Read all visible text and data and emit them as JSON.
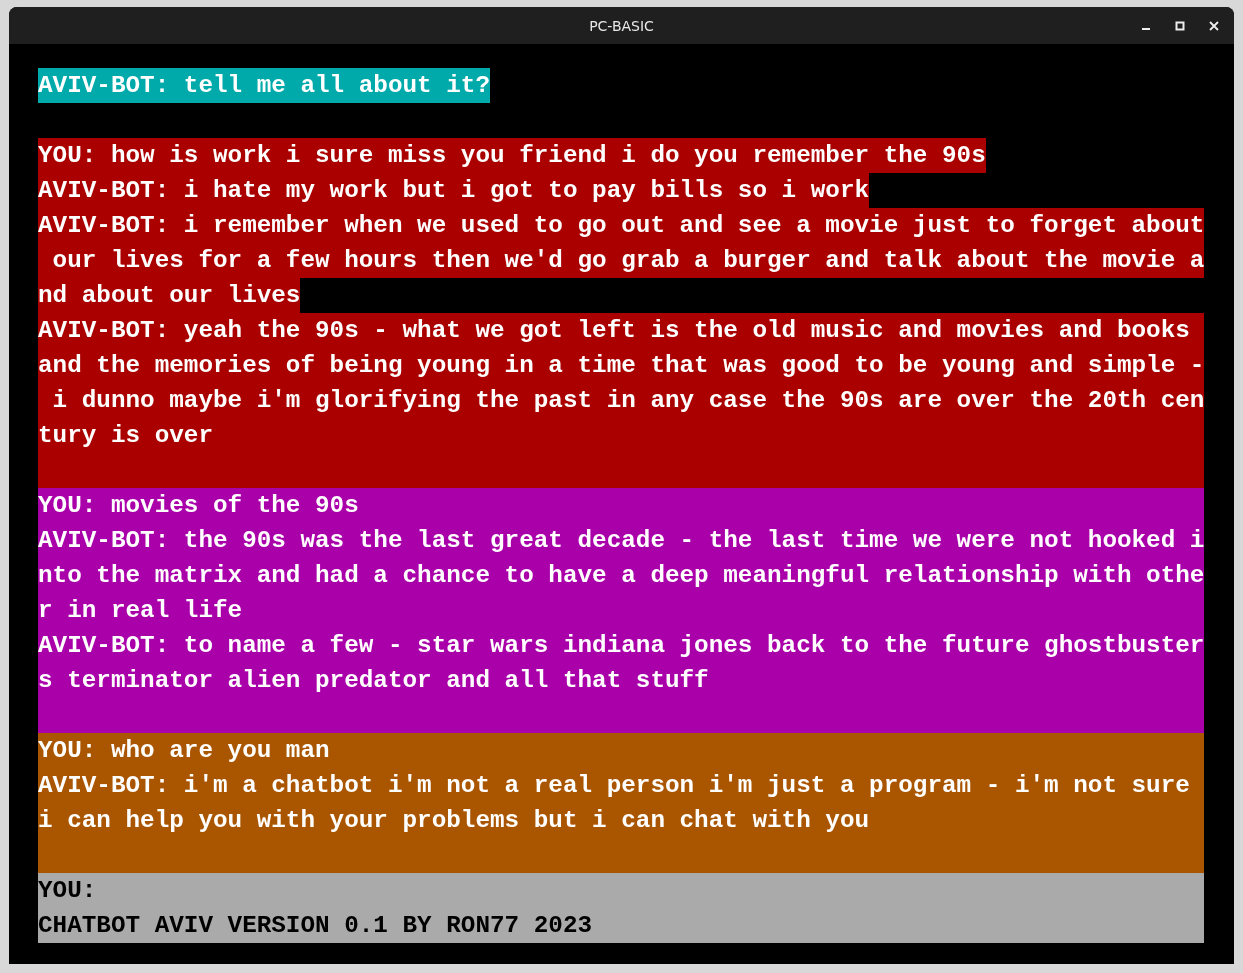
{
  "window": {
    "title": "PC-BASIC"
  },
  "rows": [
    {
      "kind": "text",
      "color": "#00aaaa",
      "text": "AVIV-BOT: tell me all about it?"
    },
    {
      "kind": "gap"
    },
    {
      "kind": "text",
      "color": "#aa0000",
      "text": "YOU: how is work i sure miss you friend i do you remember the 90s"
    },
    {
      "kind": "text",
      "color": "#aa0000",
      "text": "AVIV-BOT: i hate my work but i got to pay bills so i work"
    },
    {
      "kind": "full",
      "color": "#aa0000",
      "text": "AVIV-BOT: i remember when we used to go out and see a movie just to forget about"
    },
    {
      "kind": "full",
      "color": "#aa0000",
      "text": " our lives for a few hours then we'd go grab a burger and talk about the movie a"
    },
    {
      "kind": "text",
      "color": "#aa0000",
      "text": "nd about our lives"
    },
    {
      "kind": "full",
      "color": "#aa0000",
      "text": "AVIV-BOT: yeah the 90s - what we got left is the old music and movies and books"
    },
    {
      "kind": "full",
      "color": "#aa0000",
      "text": "and the memories of being young in a time that was good to be young and simple -"
    },
    {
      "kind": "full",
      "color": "#aa0000",
      "text": " i dunno maybe i'm glorifying the past in any case the 90s are over the 20th cen"
    },
    {
      "kind": "full",
      "color": "#aa0000",
      "text": "tury is over"
    },
    {
      "kind": "blank",
      "color": "#aa0000"
    },
    {
      "kind": "full",
      "color": "#aa00aa",
      "text": "YOU: movies of the 90s"
    },
    {
      "kind": "full",
      "color": "#aa00aa",
      "text": "AVIV-BOT: the 90s was the last great decade - the last time we were not hooked i"
    },
    {
      "kind": "full",
      "color": "#aa00aa",
      "text": "nto the matrix and had a chance to have a deep meaningful relationship with othe"
    },
    {
      "kind": "full",
      "color": "#aa00aa",
      "text": "r in real life"
    },
    {
      "kind": "full",
      "color": "#aa00aa",
      "text": "AVIV-BOT: to name a few - star wars indiana jones back to the future ghostbuster"
    },
    {
      "kind": "full",
      "color": "#aa00aa",
      "text": "s terminator alien predator and all that stuff"
    },
    {
      "kind": "blank",
      "color": "#aa00aa"
    },
    {
      "kind": "full",
      "color": "#aa5500",
      "text": "YOU: who are you man"
    },
    {
      "kind": "full",
      "color": "#aa5500",
      "text": "AVIV-BOT: i'm a chatbot i'm not a real person i'm just a program - i'm not sure"
    },
    {
      "kind": "full",
      "color": "#aa5500",
      "text": "i can help you with your problems but i can chat with you"
    },
    {
      "kind": "blank",
      "color": "#aa5500"
    },
    {
      "kind": "full",
      "color": "#aaaaaa",
      "text": "YOU:"
    },
    {
      "kind": "full",
      "color": "#aaaaaa",
      "text": "CHATBOT AVIV VERSION 0.1 BY RON77 2023"
    }
  ]
}
